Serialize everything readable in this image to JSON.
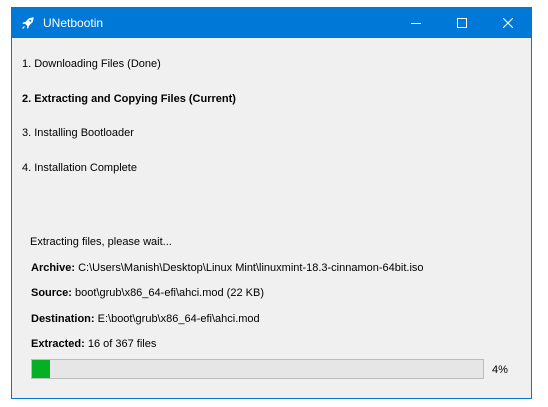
{
  "window": {
    "title": "UNetbootin",
    "accent_color": "#0078d7",
    "controls": [
      "minimize-icon",
      "maximize-icon",
      "close-icon"
    ]
  },
  "steps": [
    {
      "label": "1. Downloading Files (Done)",
      "state": "done"
    },
    {
      "label": "2. Extracting and Copying Files (Current)",
      "state": "current"
    },
    {
      "label": "3. Installing Bootloader",
      "state": "pending"
    },
    {
      "label": "4. Installation Complete",
      "state": "pending"
    }
  ],
  "status": "Extracting files, please wait...",
  "details": {
    "archive": {
      "label": "Archive:",
      "value": "C:\\Users\\Manish\\Desktop\\Linux Mint\\linuxmint-18.3-cinnamon-64bit.iso"
    },
    "source": {
      "label": "Source:",
      "value": "boot\\grub\\x86_64-efi\\ahci.mod (22 KB)"
    },
    "destination": {
      "label": "Destination:",
      "value": "E:\\boot\\grub\\x86_64-efi\\ahci.mod"
    },
    "extracted": {
      "label": "Extracted:",
      "value": "16 of 367 files"
    }
  },
  "progress": {
    "percent": 4,
    "percent_text": "4%",
    "fill_color": "#06b025"
  }
}
